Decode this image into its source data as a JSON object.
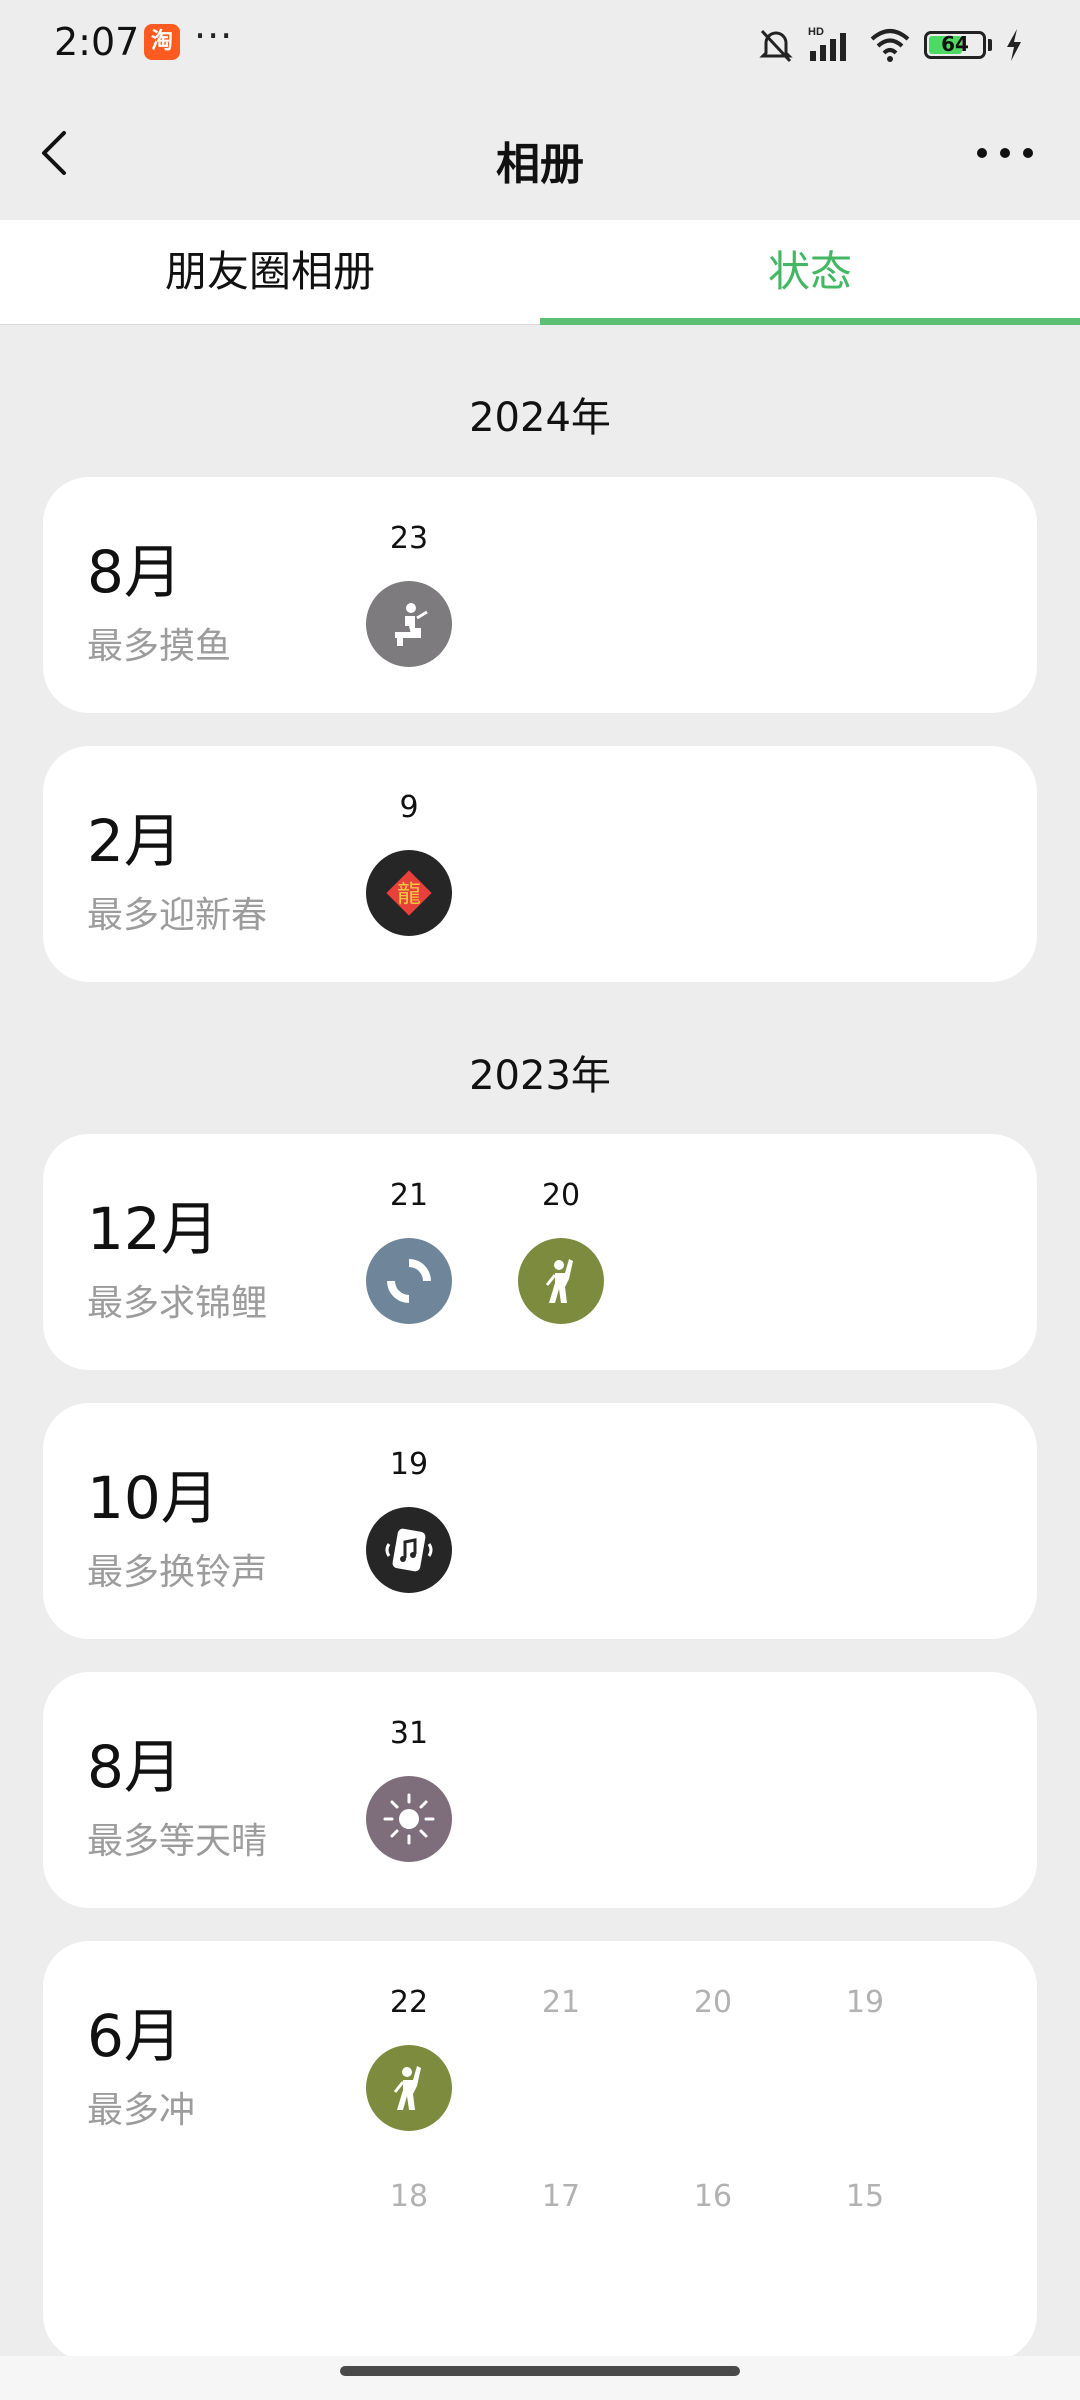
{
  "status_bar": {
    "time": "2:07",
    "app_badge": "淘",
    "more_dots": "···",
    "battery": "64",
    "battery_level": 0.64
  },
  "nav": {
    "title": "相册"
  },
  "tabs": [
    {
      "label": "朋友圈相册",
      "active": false
    },
    {
      "label": "状态",
      "active": true
    }
  ],
  "years": [
    {
      "label": "2024年",
      "months": [
        {
          "month": "8月",
          "subtitle": "最多摸鱼",
          "days": [
            {
              "day": "23",
              "icon": "slacking-icon",
              "color": "#7d7b7d"
            }
          ]
        },
        {
          "month": "2月",
          "subtitle": "最多迎新春",
          "days": [
            {
              "day": "9",
              "icon": "dragon-new-year-icon",
              "color": "#262626"
            }
          ]
        }
      ]
    },
    {
      "label": "2023年",
      "months": [
        {
          "month": "12月",
          "subtitle": "最多求锦鲤",
          "days": [
            {
              "day": "21",
              "icon": "koi-icon",
              "color": "#6f859a"
            },
            {
              "day": "20",
              "icon": "cheer-icon",
              "color": "#7d8b3f"
            }
          ]
        },
        {
          "month": "10月",
          "subtitle": "最多换铃声",
          "days": [
            {
              "day": "19",
              "icon": "ringtone-icon",
              "color": "#262626"
            }
          ]
        },
        {
          "month": "8月",
          "subtitle": "最多等天晴",
          "days": [
            {
              "day": "31",
              "icon": "sun-icon",
              "color": "#7e6d7a"
            }
          ]
        },
        {
          "month": "6月",
          "subtitle": "最多冲",
          "days": [
            {
              "day": "22",
              "icon": "cheer-icon",
              "color": "#7d8b3f"
            },
            {
              "day": "21"
            },
            {
              "day": "20"
            },
            {
              "day": "19"
            },
            {
              "day": "18"
            },
            {
              "day": "17"
            },
            {
              "day": "16"
            },
            {
              "day": "15"
            }
          ]
        }
      ]
    }
  ]
}
